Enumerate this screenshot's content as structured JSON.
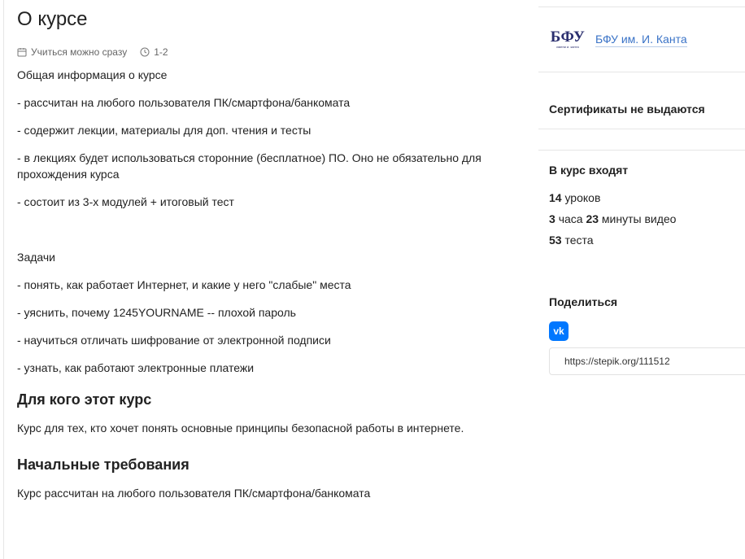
{
  "course": {
    "title": "О курсе",
    "meta": {
      "start": "Учиться можно сразу",
      "workload": "1-2"
    },
    "description": {
      "intro": "Общая информация о курсе",
      "items": [
        "- рассчитан на любого пользователя ПК/смартфона/банкомата",
        "- содержит лекции, материалы для доп. чтения и тесты",
        "- в лекциях будет использоваться сторонние (бесплатное) ПО. Оно не обязательно для прохождения курса",
        "- состоит из 3-х модулей + итоговый тест"
      ],
      "tasks_title": "Задачи",
      "tasks": [
        "- понять, как работает Интернет, и какие у него \"слабые\" места",
        "- уяснить, почему 1245YOURNAME -- плохой пароль",
        "- научиться отличать шифрование от электронной подписи",
        "- узнать, как работают электронные платежи"
      ]
    },
    "audience": {
      "title": "Для кого этот курс",
      "text": "Курс для тех, кто хочет понять основные принципы безопасной работы в интернете."
    },
    "requirements": {
      "title": "Начальные требования",
      "text": "Курс рассчитан на любого пользователя ПК/смартфона/банкомата"
    }
  },
  "sidebar": {
    "org": {
      "logo_text": "БФУ",
      "logo_subtext": "имени и. канта",
      "name": "БФУ им. И. Канта"
    },
    "certificate": "Сертификаты не выдаются",
    "contents": {
      "title": "В курс входят",
      "lessons_count": "14",
      "lessons_label": "уроков",
      "hours": "3",
      "hours_label": "часа",
      "minutes": "23",
      "minutes_label": "минуты видео",
      "tests_count": "53",
      "tests_label": "теста"
    },
    "share": {
      "title": "Поделиться",
      "vk_icon": "vk-icon",
      "url": "https://stepik.org/111512"
    }
  },
  "colors": {
    "link": "#3a73c7",
    "vk": "#0077ff",
    "logo": "#2a2e6e"
  }
}
